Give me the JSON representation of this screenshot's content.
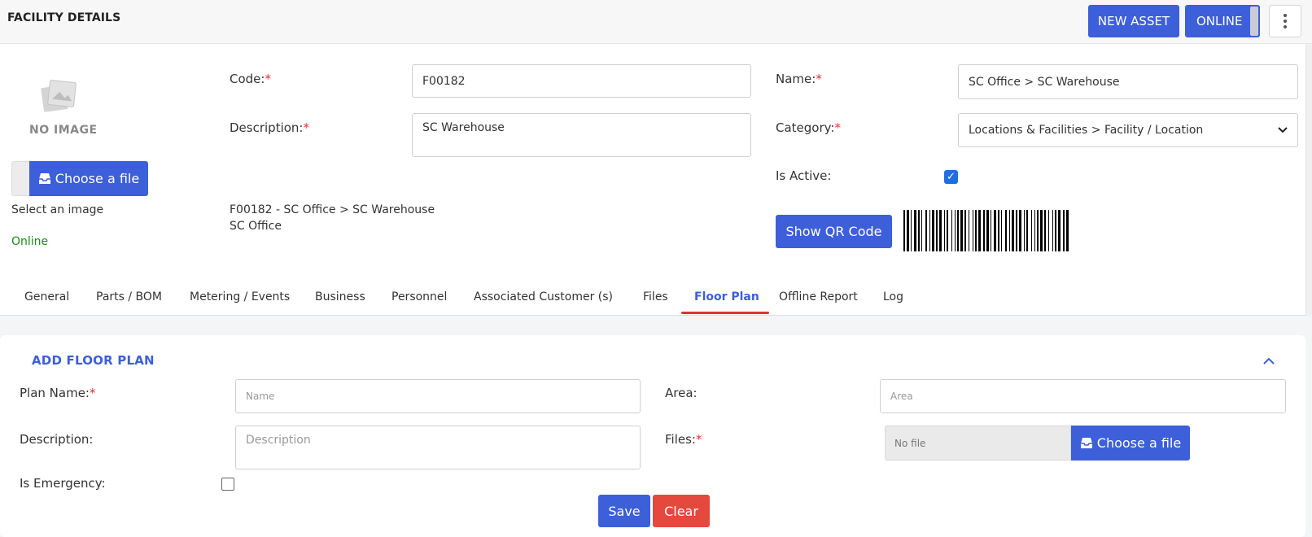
{
  "header": {
    "title": "FACILITY DETAILS",
    "new_asset_label": "NEW ASSET",
    "online_label": "ONLINE",
    "more_icon": "more-vertical-icon"
  },
  "image_panel": {
    "no_image_label": "NO IMAGE",
    "choose_file_label": "Choose a file",
    "select_image_label": "Select an image",
    "status": "Online",
    "status_color": "#1a8a1a"
  },
  "form": {
    "code_label": "Code:",
    "code_value": "F00182",
    "description_label": "Description:",
    "description_value": "SC Warehouse",
    "summary_line1": "F00182 - SC Office > SC Warehouse",
    "summary_line2": "SC Office",
    "name_label": "Name:",
    "name_value": "SC Office > SC Warehouse",
    "category_label": "Category:",
    "category_value": "Locations & Facilities > Facility / Location",
    "is_active_label": "Is Active:",
    "is_active_checked": true,
    "qr_button_label": "Show QR Code",
    "required_mark": "*"
  },
  "tabs": [
    {
      "label": "General"
    },
    {
      "label": "Parts / BOM"
    },
    {
      "label": "Metering / Events"
    },
    {
      "label": "Business"
    },
    {
      "label": "Personnel"
    },
    {
      "label": "Associated Customer (s)"
    },
    {
      "label": "Files"
    },
    {
      "label": "Floor Plan",
      "active": true
    },
    {
      "label": "Offline Report"
    },
    {
      "label": "Log"
    }
  ],
  "floor_plan": {
    "title": "ADD FLOOR PLAN",
    "plan_name_label": "Plan Name:",
    "plan_name_placeholder": "Name",
    "area_label": "Area:",
    "area_placeholder": "Area",
    "description_label": "Description:",
    "description_placeholder": "Description",
    "files_label": "Files:",
    "no_file_text": "No file",
    "choose_file_label": "Choose a file",
    "is_emergency_label": "Is Emergency:",
    "save_label": "Save",
    "clear_label": "Clear"
  },
  "colors": {
    "accent": "#3d5fd9",
    "required": "#e03131",
    "danger": "#e5483d",
    "tab_underline": "#e03131"
  }
}
